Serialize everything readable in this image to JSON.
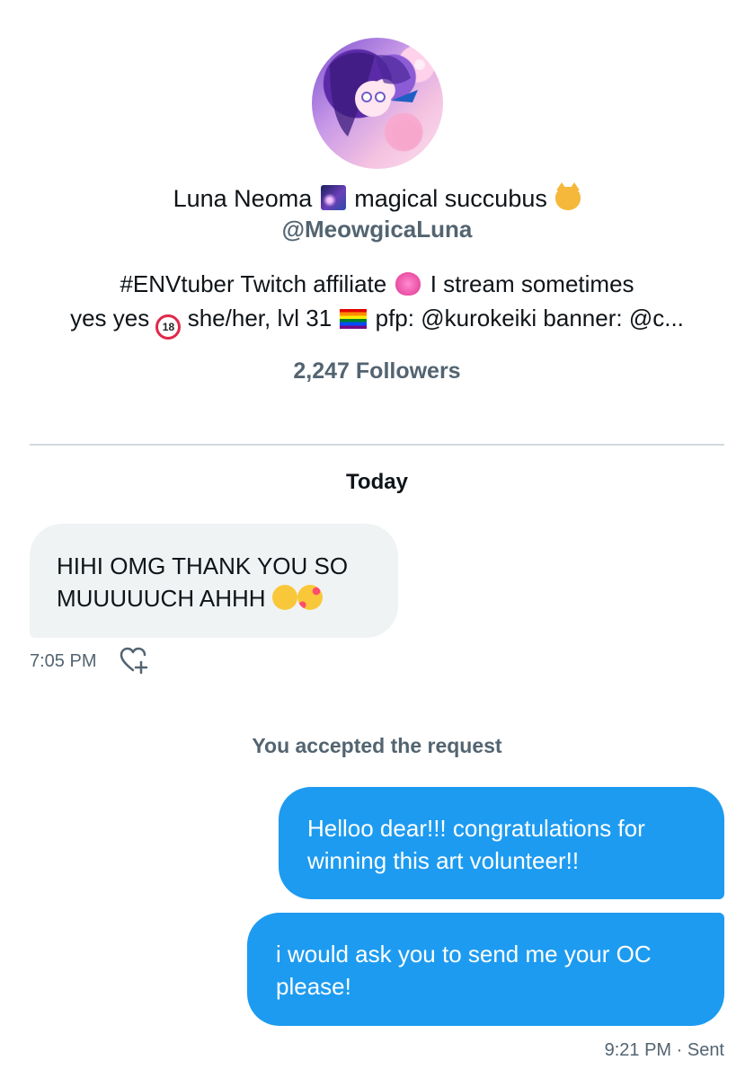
{
  "profile": {
    "name_part1": "Luna Neoma",
    "name_part2": "magical succubus",
    "handle": "@MeowgicaLuna",
    "bio_line1_part1": "#ENVtuber Twitch affiliate",
    "bio_line1_part2": "I stream sometimes",
    "bio_line2_part1": "yes yes",
    "bio_line2_part2": "she/her, lvl 31",
    "bio_line2_part3": "pfp: @kurokeiki banner: @c...",
    "followers": "2,247 Followers",
    "emoji_18_text": "18"
  },
  "conversation": {
    "date_header": "Today",
    "messages": [
      {
        "direction": "incoming",
        "text": "HIHI OMG THANK YOU SO MUUUUUCH AHHH",
        "time": "7:05 PM"
      },
      {
        "direction": "system",
        "text": "You accepted the request"
      },
      {
        "direction": "outgoing",
        "text": "Helloo dear!!! congratulations for winning this art volunteer!!"
      },
      {
        "direction": "outgoing",
        "text": "i would ask you to send me your OC please!",
        "meta": "9:21 PM · Sent"
      }
    ]
  },
  "icons": {
    "react": "heart-plus-icon",
    "galaxy": "milky-way-emoji",
    "cat": "cat-face-emoji",
    "heart": "sparkling-heart-emoji",
    "adult": "no-one-under-eighteen-emoji",
    "flag": "rainbow-flag-emoji",
    "pleading": "pleading-face-emoji",
    "hearts_face": "smiling-face-with-hearts-emoji"
  },
  "colors": {
    "outgoing_bubble": "#1d9bf0",
    "incoming_bubble": "#eff3f4",
    "secondary_text": "#536471"
  }
}
